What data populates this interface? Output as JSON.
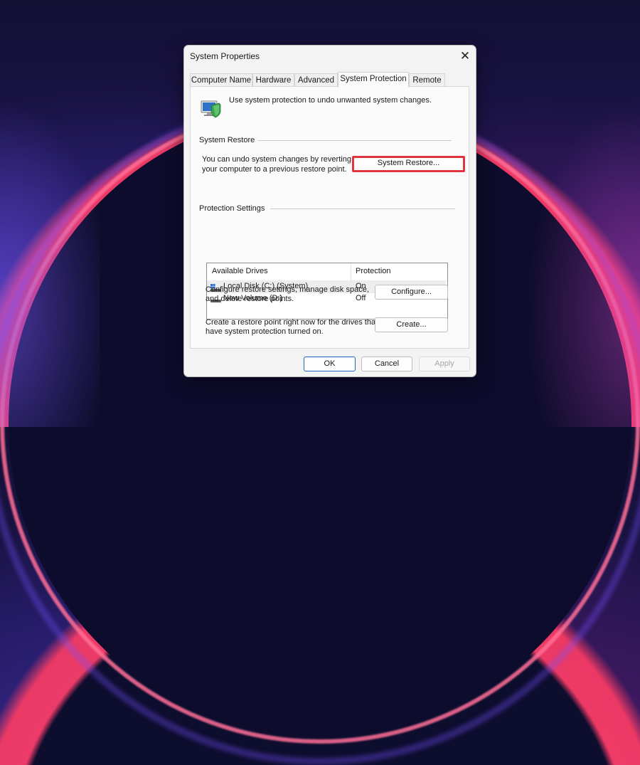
{
  "window": {
    "title": "System Properties",
    "close_glyph": "✕"
  },
  "tabs": [
    {
      "label": "Computer Name",
      "active": false
    },
    {
      "label": "Hardware",
      "active": false
    },
    {
      "label": "Advanced",
      "active": false
    },
    {
      "label": "System Protection",
      "active": true
    },
    {
      "label": "Remote",
      "active": false
    }
  ],
  "intro": {
    "icon": "system-protection-icon",
    "text": "Use system protection to undo unwanted system changes."
  },
  "system_restore": {
    "heading": "System Restore",
    "description_line1": "You can undo system changes by reverting",
    "description_line2": "your computer to a previous restore point.",
    "button_label": "System Restore...",
    "highlight_color": "#e0343f"
  },
  "protection_settings": {
    "heading": "Protection Settings",
    "columns": [
      "Available Drives",
      "Protection"
    ],
    "drives": [
      {
        "name": "Local Disk (C:) (System)",
        "protection": "On",
        "icon": "system-drive-icon",
        "selected": true
      },
      {
        "name": "New Volume (D:)",
        "protection": "Off",
        "icon": "drive-icon",
        "selected": false
      }
    ]
  },
  "configure": {
    "text_line1": "Configure restore settings, manage disk space,",
    "text_line2": "and delete restore points.",
    "button_label": "Configure..."
  },
  "create": {
    "text_line1": "Create a restore point right now for the drives that",
    "text_line2": "have system protection turned on.",
    "button_label": "Create..."
  },
  "footer": {
    "ok_label": "OK",
    "cancel_label": "Cancel",
    "apply_label": "Apply",
    "accent_color": "#1e63c4"
  }
}
